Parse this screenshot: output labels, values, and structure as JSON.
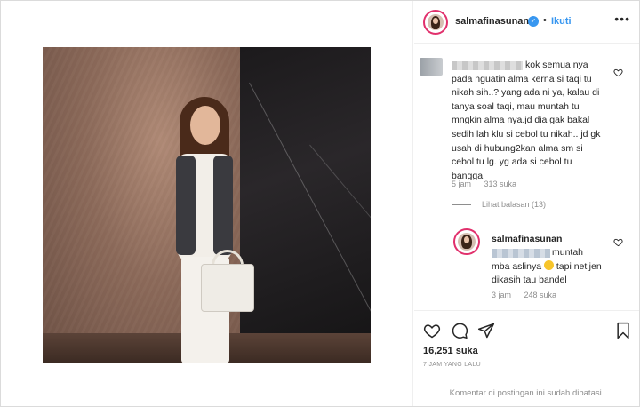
{
  "header": {
    "username": "salmafinasunan",
    "separator": "•",
    "follow_label": "Ikuti",
    "more_icon": "more-horizontal-icon"
  },
  "comment": {
    "text": "kok semua nya pada nguatin alma kerna si taqi tu nikah sih..? yang ada ni ya, kalau di tanya soal taqi, mau muntah tu mngkin alma nya.jd dia gak bakal sedih lah klu si cebol tu nikah.. jd gk usah di hubung2kan alma sm si cebol tu lg. yg ada si cebol tu bangga,",
    "time": "5 jam",
    "likes": "313 suka",
    "view_replies": "Lihat balasan (13)"
  },
  "reply": {
    "username": "salmafinasunan",
    "text_before_emoji": "muntah mba aslinya",
    "text_after_emoji": "tapi netijen dikasih tau bandel",
    "time": "3 jam",
    "likes": "248 suka"
  },
  "post": {
    "likes": "16,251 suka",
    "timestamp": "7 JAM YANG LALU",
    "comments_closed": "Komentar di postingan ini sudah dibatasi."
  },
  "colors": {
    "accent": "#3897f0",
    "story_ring": "#e1306c",
    "muted": "#8e8e8e"
  }
}
